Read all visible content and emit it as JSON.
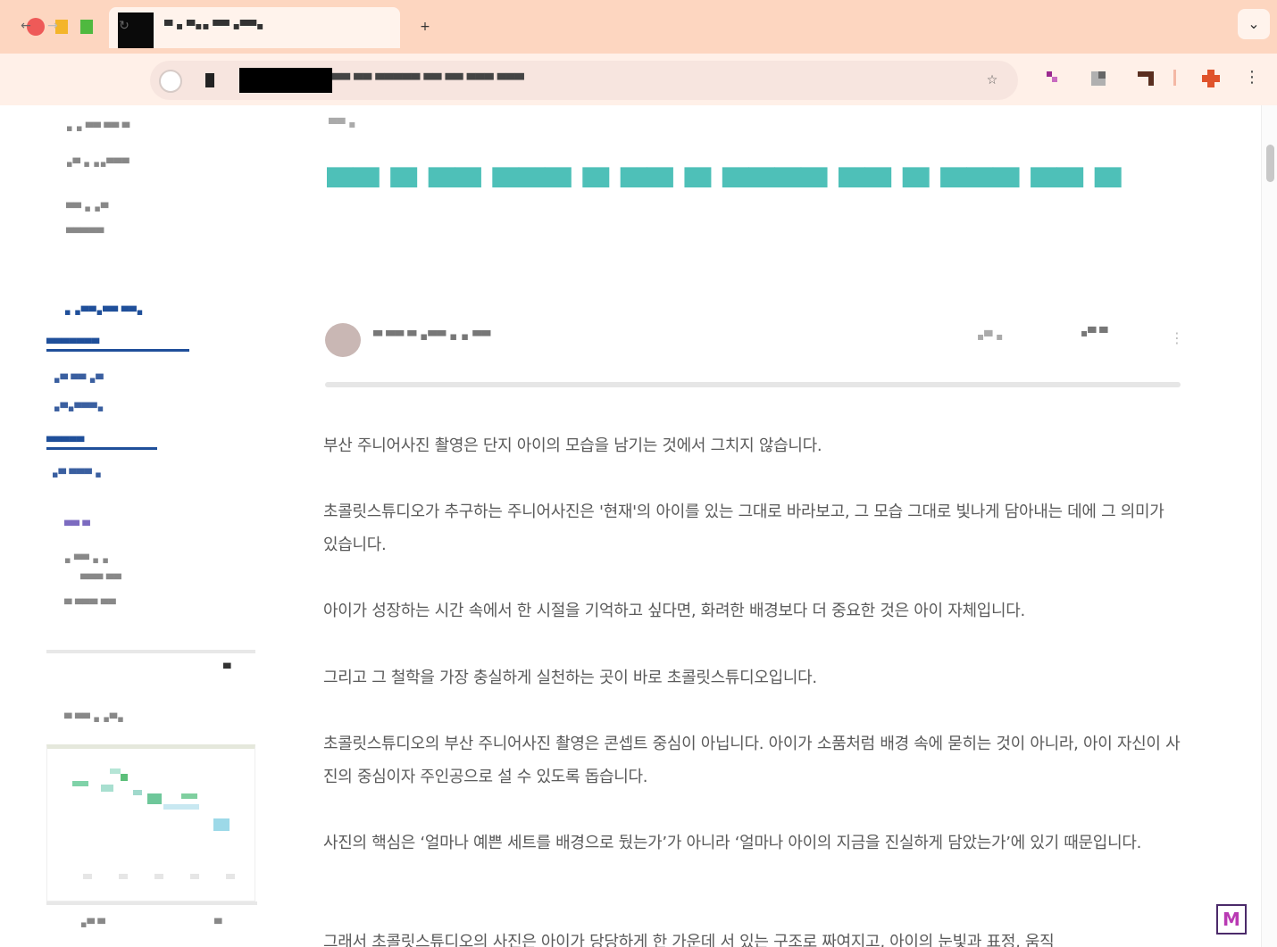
{
  "browser": {
    "tab_title": "▀ ▪ ▀▪▪ ▀▀ ▪▀▀▪",
    "new_tab_label": "+",
    "tab_menu_label": "⌄",
    "nav_back": "←",
    "nav_forward": "→",
    "nav_reload": "↻",
    "url_text": "▀▀ ▀▀ ▀▀▀▀▀ ▀▀ ▀▀ ▀▀▀ ▀▀▀",
    "bookmark_label": "☆",
    "menu_label": "⋮",
    "colors": {
      "titlebar": "#fdd6c0",
      "toolbar": "#fff0e8",
      "traffic_red": "#ee5a58",
      "traffic_yellow": "#f4b52a",
      "traffic_green": "#4fb93f"
    }
  },
  "sidebar": {
    "blocks": [
      "▪ ▪ ▀▀ ▀▀ ▀",
      "▪▀ ▪ ▪▪▀▀▀",
      "▀▀ ▪ ▪▀",
      "▀▀▀▀▀",
      "▪ ▪▀▀▪▀▀ ▀▀▪",
      "▀▀▀▀▀▀▀",
      "▪▀ ▀▀ ▪▀",
      "▪▀▪▀▀▀▪",
      "▀▀▀▀▀",
      "▪▀ ▀▀▀ ▪",
      "▀▀ ▀",
      "▪ ▀▀ ▪ ▪",
      "▀▀▀ ▀▀",
      "▀ ▀▀▀ ▀▀",
      "▀",
      "▀ ▀▀ ▪ ▪▀▪",
      "▪▀ ▀",
      "▀"
    ]
  },
  "article": {
    "breadcrumb": "▀▀ ▪",
    "title": "▀▀ ▀ ▀▀ ▀▀▀ ▀ ▀▀ ▀ ▀▀▀▀ ▀▀ ▀ ▀▀▀ ▀▀ ▀",
    "author": "▀ ▀▀ ▀ ▪▀▀ ▪ ▪ ▀▀",
    "date": "▪▀ ▪",
    "meta_action": "▪▀ ▀",
    "more_label": "⋮",
    "accent_color": "#4ec0b8",
    "paragraphs": [
      "부산 주니어사진 촬영은 단지 아이의 모습을 남기는 것에서 그치지 않습니다.",
      "초콜릿스튜디오가 추구하는 주니어사진은 '현재'의 아이를 있는 그대로 바라보고, 그 모습 그대로 빛나게 담아내는 데에 그 의미가 있습니다.",
      "아이가 성장하는 시간 속에서 한 시절을 기억하고 싶다면, 화려한 배경보다 더 중요한 것은 아이 자체입니다.",
      "그리고 그 철학을 가장 충실하게 실천하는 곳이 바로 초콜릿스튜디오입니다.",
      "초콜릿스튜디오의 부산 주니어사진 촬영은 콘셉트 중심이 아닙니다. 아이가 소품처럼 배경 속에 묻히는 것이 아니라, 아이 자신이 사진의 중심이자 주인공으로 설 수 있도록 돕습니다.",
      "사진의 핵심은 ‘얼마나 예쁜 세트를 배경으로 뒀는가’가 아니라 ‘얼마나 아이의 지금을 진실하게 담았는가’에 있기 때문입니다.",
      "그래서 초콜릿스튜디오의 사진은 아이가 당당하게 한 가운데 서 있는 구조로 짜여지고, 아이의 눈빛과 표정, 움직"
    ]
  },
  "widget": {
    "label": "M"
  }
}
